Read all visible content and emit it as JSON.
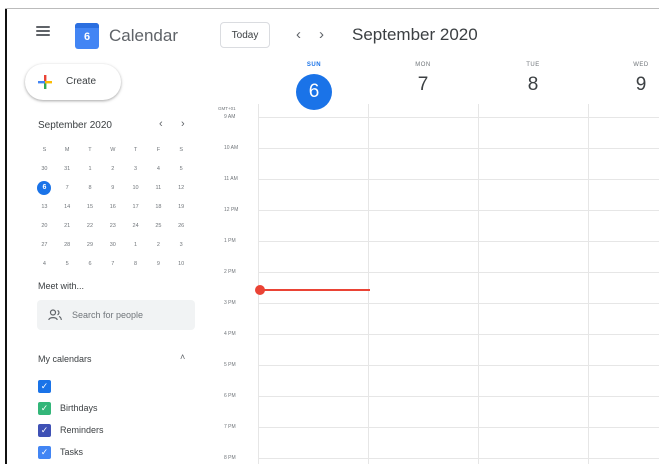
{
  "header": {
    "app_title": "Calendar",
    "logo_day": "6",
    "today_label": "Today",
    "prev_symbol": "‹",
    "next_symbol": "›",
    "month_title": "September 2020"
  },
  "sidebar": {
    "create_label": "Create",
    "mini_calendar": {
      "title": "September 2020",
      "prev_symbol": "‹",
      "next_symbol": "›",
      "weekday_headers": [
        "S",
        "M",
        "T",
        "W",
        "T",
        "F",
        "S"
      ],
      "weeks": [
        [
          "30",
          "31",
          "1",
          "2",
          "3",
          "4",
          "5"
        ],
        [
          "6",
          "7",
          "8",
          "9",
          "10",
          "11",
          "12"
        ],
        [
          "13",
          "14",
          "15",
          "16",
          "17",
          "18",
          "19"
        ],
        [
          "20",
          "21",
          "22",
          "23",
          "24",
          "25",
          "26"
        ],
        [
          "27",
          "28",
          "29",
          "30",
          "1",
          "2",
          "3"
        ],
        [
          "4",
          "5",
          "6",
          "7",
          "8",
          "9",
          "10"
        ]
      ],
      "today": "6"
    },
    "meet_with_title": "Meet with...",
    "search_people_placeholder": "Search for people",
    "my_calendars_title": "My calendars",
    "my_calendars": [
      {
        "label": "",
        "color": "#1a73e8"
      },
      {
        "label": "Birthdays",
        "color": "#33b679"
      },
      {
        "label": "Reminders",
        "color": "#3f51b5"
      },
      {
        "label": "Tasks",
        "color": "#4285f4"
      }
    ]
  },
  "week": {
    "timezone_label": "GMT+01",
    "days": [
      {
        "name": "SUN",
        "number": "6",
        "active": true
      },
      {
        "name": "MON",
        "number": "7",
        "active": false
      },
      {
        "name": "TUE",
        "number": "8",
        "active": false
      },
      {
        "name": "WED",
        "number": "9",
        "active": false
      }
    ],
    "time_labels": [
      "9 AM",
      "10 AM",
      "11 AM",
      "12 PM",
      "1 PM",
      "2 PM",
      "3 PM",
      "4 PM",
      "5 PM",
      "6 PM",
      "7 PM",
      "8 PM"
    ]
  },
  "colors": {
    "accent": "#1a73e8",
    "now_indicator": "#ea4335"
  }
}
